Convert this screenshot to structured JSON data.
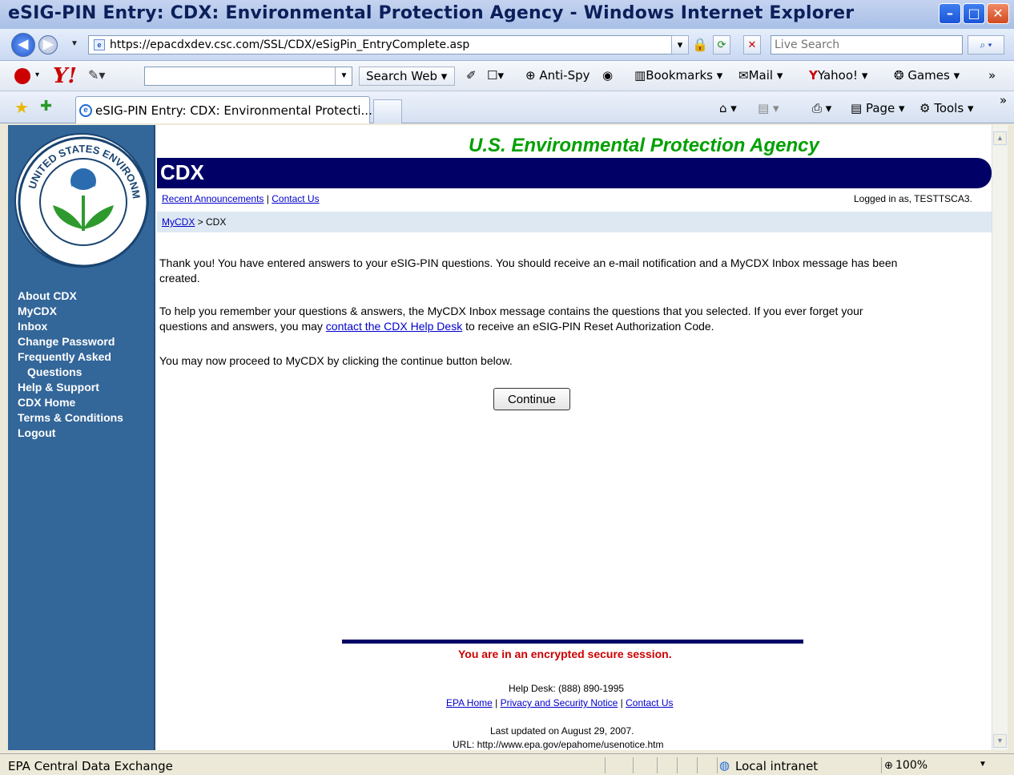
{
  "window": {
    "title": "eSIG-PIN Entry: CDX: Environmental Protection Agency - Windows Internet Explorer"
  },
  "address": {
    "url": "https://epacdxdev.csc.com/SSL/CDX/eSigPin_EntryComplete.asp",
    "search_placeholder": "Live Search"
  },
  "yahoo_toolbar": {
    "search_button": "Search Web",
    "anti_spy": "Anti-Spy",
    "bookmarks": "Bookmarks",
    "mail": "Mail",
    "yahoo": "Yahoo!",
    "games": "Games"
  },
  "tabs": {
    "active_label": "eSIG-PIN Entry: CDX: Environmental Protecti..."
  },
  "command_bar": {
    "page": "Page",
    "tools": "Tools"
  },
  "sidebar": {
    "items": [
      {
        "label": "About CDX"
      },
      {
        "label": "MyCDX"
      },
      {
        "label": "Inbox"
      },
      {
        "label": "Change Password"
      },
      {
        "label": "Frequently Asked"
      },
      {
        "label": "Questions"
      },
      {
        "label": "Help & Support"
      },
      {
        "label": "CDX Home"
      },
      {
        "label": "Terms & Conditions"
      },
      {
        "label": "Logout"
      }
    ],
    "seal_text": "UNITED STATES ENVIRONMENTAL PROTECTION AGENCY"
  },
  "header": {
    "agency": "U.S. Environmental Protection Agency",
    "title": "CDX",
    "recent_announcements": "Recent Announcements",
    "separator": "|",
    "contact_us": "Contact Us",
    "logged_in": "Logged in as, TESTTSCA3.",
    "breadcrumb_link": "MyCDX",
    "breadcrumb_rest": " > CDX"
  },
  "main": {
    "para1": "Thank you! You have entered answers to your eSIG-PIN questions. You should receive an e-mail notification and a MyCDX Inbox message has been created.",
    "para2_before": "To help you remember your questions & answers, the MyCDX Inbox message contains the questions that you selected. If you ever forget your questions and answers, you may ",
    "para2_link": "contact the CDX Help Desk",
    "para2_after": " to receive an eSIG-PIN Reset Authorization Code.",
    "para3": "You may now proceed to MyCDX by clicking the continue button below.",
    "continue_label": "Continue"
  },
  "footer": {
    "secure": "You are in an encrypted secure session.",
    "helpdesk": "Help Desk: (888) 890-1995",
    "epa_home": "EPA Home",
    "privacy": "Privacy and Security Notice",
    "contact": "Contact Us",
    "updated": "Last updated on August 29, 2007.",
    "url": "URL: http://www.epa.gov/epahome/usenotice.htm"
  },
  "status": {
    "text": "EPA Central Data Exchange",
    "zone": "Local intranet",
    "zoom": "100%"
  }
}
